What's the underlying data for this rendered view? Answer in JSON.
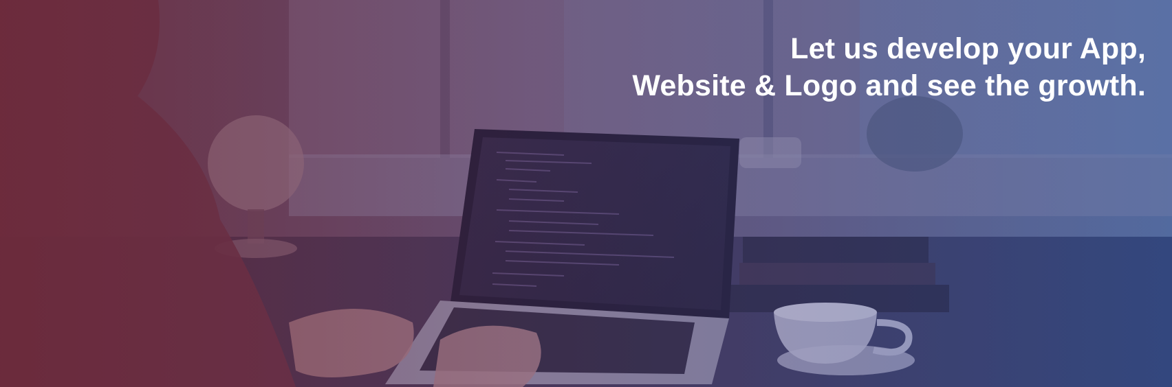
{
  "hero": {
    "headline_line1": "Let us develop your App,",
    "headline_line2": "Website & Logo and see the growth."
  },
  "colors": {
    "overlay_left": "#6e283c",
    "overlay_mid": "#5a3c6e",
    "overlay_right": "#325096",
    "text": "#ffffff"
  },
  "icons": [
    "laptop-photo"
  ]
}
